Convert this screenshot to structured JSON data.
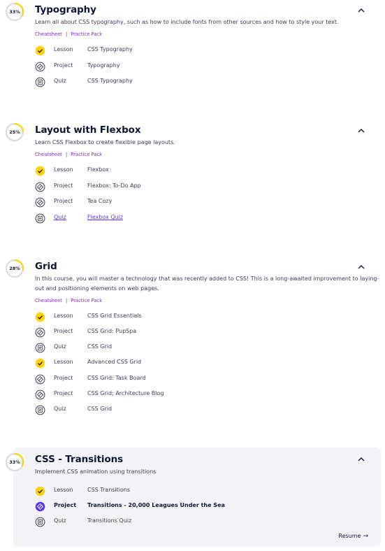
{
  "colors": {
    "ring_track": "#dcdcdc",
    "ring_progress": "#ffd300",
    "link_purple": "#7b2cdd",
    "active_purple": "#5533ff",
    "check_yellow": "#ffd300",
    "highlight_bg": "#f4f4f8"
  },
  "sections": [
    {
      "progress": "33%",
      "progress_fraction": 0.33,
      "title": "Typography",
      "description": "Learn all about CSS typography, such as how to include fonts from other sources and how to style your text.",
      "cheatsheet": "Cheatsheet",
      "separator": "|",
      "practice_pack": "Practice Pack",
      "items": [
        {
          "icon": "check-icon",
          "type": "Lesson",
          "name": "CSS Typography"
        },
        {
          "icon": "project-icon",
          "type": "Project",
          "name": "Typography"
        },
        {
          "icon": "quiz-icon",
          "type": "Quiz",
          "name": "CSS Typography"
        }
      ]
    },
    {
      "progress": "25%",
      "progress_fraction": 0.25,
      "title": "Layout with Flexbox",
      "description": "Learn CSS Flexbox to create flexible page layouts.",
      "cheatsheet": "Cheatsheet",
      "separator": "|",
      "practice_pack": "Practice Pack",
      "items": [
        {
          "icon": "check-icon",
          "type": "Lesson",
          "name": "Flexbox"
        },
        {
          "icon": "project-icon",
          "type": "Project",
          "name": "Flexbox: To-Do App"
        },
        {
          "icon": "project-icon",
          "type": "Project",
          "name": "Tea Cozy"
        },
        {
          "icon": "quiz-icon",
          "type": "Quiz",
          "name": "Flexbox Quiz"
        }
      ]
    },
    {
      "progress": "28%",
      "progress_fraction": 0.28,
      "title": "Grid",
      "description_line1": "In this course, you will master a technology that was recently added to CSS! This is a long-awaited improvement to laying-",
      "description_line2": "out and positioning elements on web pages.",
      "cheatsheet": "Cheatsheet",
      "separator": "|",
      "practice_pack": "Practice Pack",
      "items": [
        {
          "icon": "check-icon",
          "type": "Lesson",
          "name": "CSS Grid Essentials"
        },
        {
          "icon": "project-icon",
          "type": "Project",
          "name": "CSS Grid: PupSpa"
        },
        {
          "icon": "quiz-icon",
          "type": "Quiz",
          "name": "CSS Grid"
        },
        {
          "icon": "check-icon",
          "type": "Lesson",
          "name": "Advanced CSS Grid"
        },
        {
          "icon": "project-icon",
          "type": "Project",
          "name": "CSS Grid: Task Board"
        },
        {
          "icon": "project-icon",
          "type": "Project",
          "name": "CSS Grid: Architecture Blog"
        },
        {
          "icon": "quiz-icon",
          "type": "Quiz",
          "name": "CSS Grid"
        }
      ]
    },
    {
      "progress": "33%",
      "progress_fraction": 0.33,
      "title": "CSS - Transitions",
      "description": "Implement CSS animation using transitions",
      "items": [
        {
          "icon": "check-icon",
          "type": "Lesson",
          "name": "CSS Transitions"
        },
        {
          "icon": "project-active-icon",
          "type": "Project",
          "name": "Transitions - 20,000 Leagues Under the Sea"
        },
        {
          "icon": "quiz-icon",
          "type": "Quiz",
          "name": "Transitions Quiz"
        }
      ],
      "resume_label": "Resume",
      "resume_arrow": "→"
    }
  ]
}
